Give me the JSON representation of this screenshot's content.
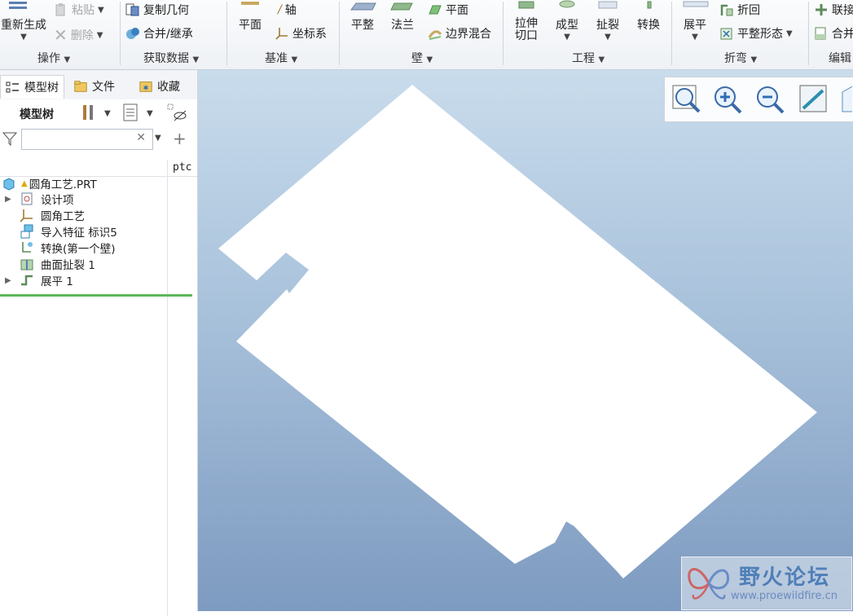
{
  "ribbon": {
    "operations": {
      "label": "操作",
      "regenerate": "重新生成",
      "paste": "粘贴",
      "delete": "删除"
    },
    "get_data": {
      "label": "获取数据",
      "copy_geometry": "复制几何",
      "merge_inherit": "合并/继承"
    },
    "datum": {
      "label": "基准",
      "plane": "平面",
      "axis": "轴",
      "csys": "坐标系"
    },
    "wall": {
      "label": "壁",
      "flat": "平整",
      "flange": "法兰",
      "plane": "平面",
      "boundary_blend": "边界混合"
    },
    "engineering": {
      "label": "工程",
      "extrude_cut_1": "拉伸",
      "extrude_cut_2": "切口",
      "form": "成型",
      "rip": "扯裂",
      "convert": "转换"
    },
    "bend": {
      "label": "折弯",
      "unbend": "展平",
      "bend_back": "折回",
      "flat_state": "平整形态"
    },
    "edit": {
      "label": "编辑",
      "join": "联接",
      "merge": "合并"
    }
  },
  "left_panel": {
    "tabs": [
      {
        "label": "模型树"
      },
      {
        "label": "文件"
      },
      {
        "label": "收藏"
      }
    ],
    "tree_title": "模型树",
    "column_header": "ptc",
    "tree": [
      {
        "label": "圆角工艺.PRT"
      },
      {
        "label": "设计项"
      },
      {
        "label": "圆角工艺"
      },
      {
        "label": "导入特征 标识5"
      },
      {
        "label": "转换(第一个壁)"
      },
      {
        "label": "曲面扯裂 1"
      },
      {
        "label": "展平 1"
      }
    ]
  },
  "watermark": {
    "title": "野火论坛",
    "url": "www.proewildfire.cn"
  },
  "colors": {
    "accent": "#2e6db4",
    "tree_highlight": "#5cb85c",
    "viewport_top": "#c9dcec",
    "viewport_bottom": "#7d9ac0"
  }
}
